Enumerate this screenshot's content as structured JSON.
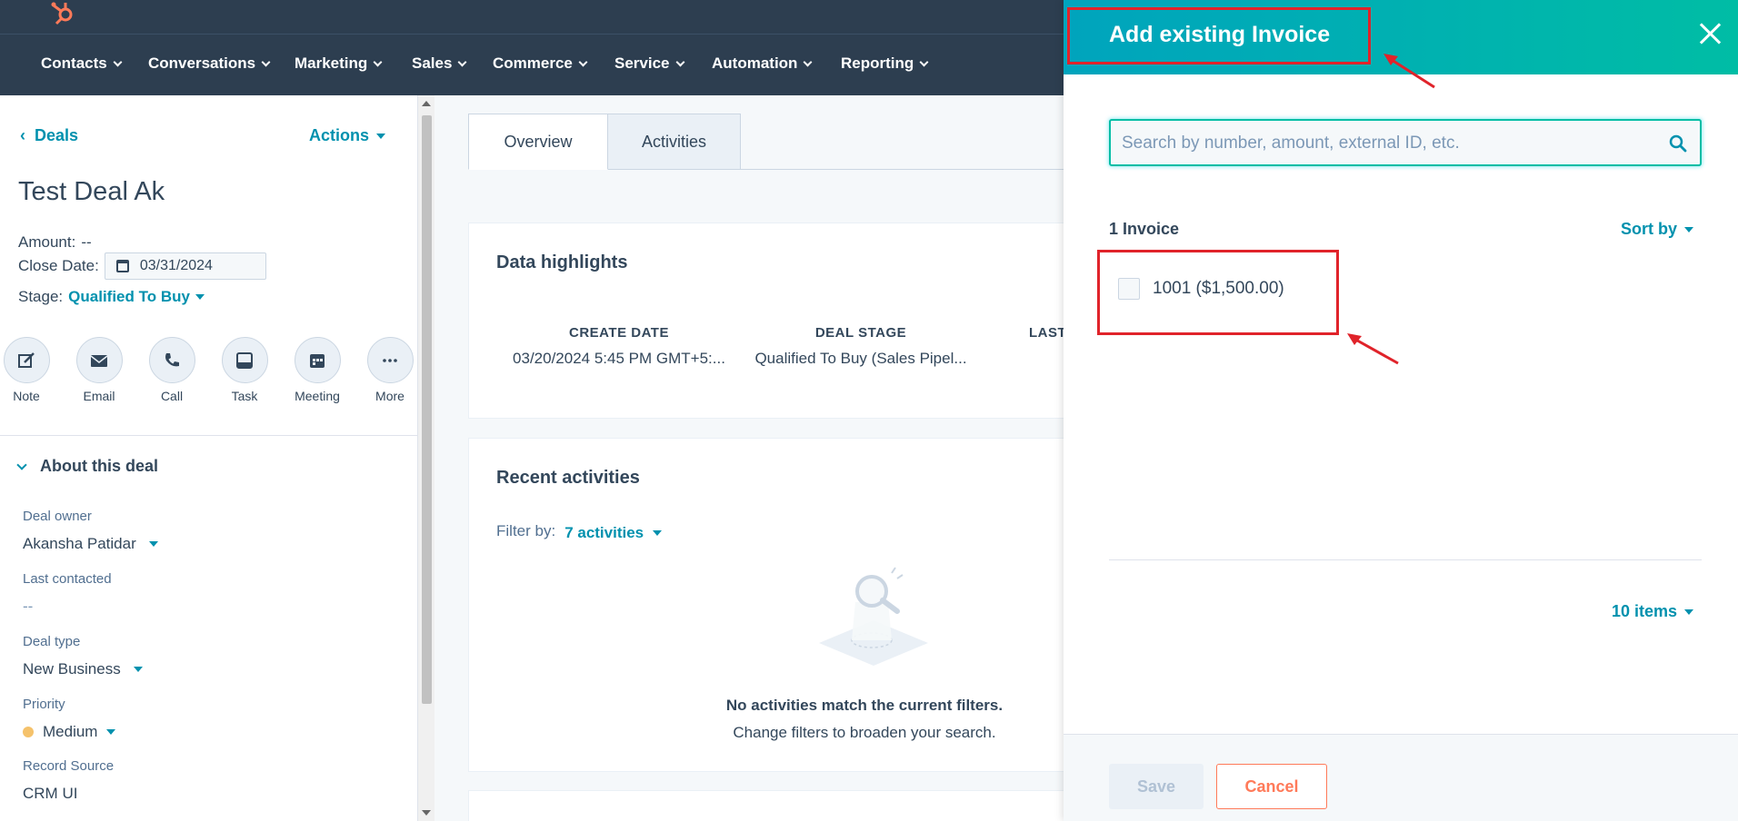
{
  "colors": {
    "nav_bg": "#2d3e50",
    "accent": "#0091ae",
    "panel_header": "#00a4bd",
    "cancel": "#ff7a59",
    "annotation_red": "#e0232a",
    "priority_medium": "#f5c26b"
  },
  "nav": {
    "items": [
      "Contacts",
      "Conversations",
      "Marketing",
      "Sales",
      "Commerce",
      "Service",
      "Automation",
      "Reporting"
    ]
  },
  "sidebar": {
    "back_label": "Deals",
    "actions_label": "Actions",
    "deal_title": "Test Deal Ak",
    "amount_label": "Amount:",
    "amount_value": "--",
    "close_date_label": "Close Date:",
    "close_date_value": "03/31/2024",
    "stage_label": "Stage:",
    "stage_value": "Qualified To Buy",
    "quick_actions": [
      {
        "label": "Note",
        "icon": "note-icon"
      },
      {
        "label": "Email",
        "icon": "email-icon"
      },
      {
        "label": "Call",
        "icon": "call-icon"
      },
      {
        "label": "Task",
        "icon": "task-icon"
      },
      {
        "label": "Meeting",
        "icon": "meeting-icon"
      },
      {
        "label": "More",
        "icon": "more-icon"
      }
    ],
    "about_title": "About this deal",
    "fields": [
      {
        "label": "Deal owner",
        "value": "Akansha Patidar"
      },
      {
        "label": "Last contacted",
        "value": "--"
      },
      {
        "label": "Deal type",
        "value": "New Business"
      },
      {
        "label": "Priority",
        "value": "Medium"
      },
      {
        "label": "Record Source",
        "value": "CRM UI"
      }
    ]
  },
  "main": {
    "tabs": [
      "Overview",
      "Activities"
    ],
    "highlights": {
      "title": "Data highlights",
      "columns": [
        {
          "header": "CREATE DATE",
          "value": "03/20/2024 5:45 PM GMT+5:..."
        },
        {
          "header": "DEAL STAGE",
          "value": "Qualified To Buy (Sales Pipel..."
        },
        {
          "header": "LAST",
          "value": ""
        }
      ]
    },
    "recent": {
      "title": "Recent activities",
      "filter_label": "Filter by:",
      "filter_value": "7 activities",
      "empty_title": "No activities match the current filters.",
      "empty_sub": "Change filters to broaden your search."
    }
  },
  "panel": {
    "title": "Add existing Invoice",
    "search_placeholder": "Search by number, amount, external ID, etc.",
    "count_label": "1 Invoice",
    "sort_label": "Sort by",
    "invoices": [
      {
        "label": "1001 ($1,500.00)"
      }
    ],
    "items_label": "10 items",
    "save_label": "Save",
    "cancel_label": "Cancel"
  }
}
